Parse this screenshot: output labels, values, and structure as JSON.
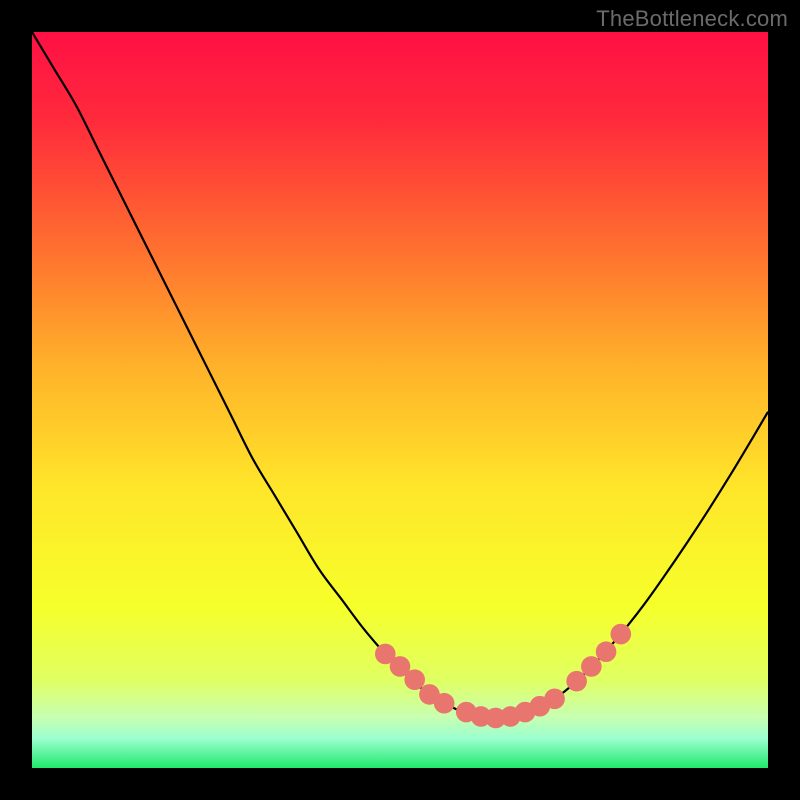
{
  "watermark": "TheBottleneck.com",
  "chart_data": {
    "type": "line",
    "title": "",
    "xlabel": "",
    "ylabel": "",
    "xlim": [
      0,
      100
    ],
    "ylim": [
      0,
      100
    ],
    "gradient_stops": [
      {
        "offset": 0,
        "color": "#ff1044"
      },
      {
        "offset": 12,
        "color": "#ff2a3c"
      },
      {
        "offset": 28,
        "color": "#ff6a30"
      },
      {
        "offset": 45,
        "color": "#ffb02a"
      },
      {
        "offset": 62,
        "color": "#ffe62a"
      },
      {
        "offset": 78,
        "color": "#f6ff2a"
      },
      {
        "offset": 88,
        "color": "#e0ff62"
      },
      {
        "offset": 93,
        "color": "#c8ffb0"
      },
      {
        "offset": 96,
        "color": "#9cffd0"
      },
      {
        "offset": 100,
        "color": "#20e86c"
      }
    ],
    "series": [
      {
        "name": "curve",
        "stroke": "#000000",
        "x": [
          0,
          3,
          6,
          9,
          12,
          15,
          18,
          21,
          24,
          27,
          30,
          33,
          36,
          39,
          42,
          45,
          48,
          51,
          54,
          57,
          59,
          61,
          63,
          65,
          68,
          71,
          74,
          77,
          80,
          83,
          86,
          89,
          92,
          95,
          98,
          100
        ],
        "y": [
          100,
          95,
          90,
          84,
          78,
          72,
          66,
          60,
          54,
          48,
          42,
          37,
          32,
          27,
          23,
          19,
          15.5,
          12.5,
          10,
          8.3,
          7.4,
          6.9,
          6.7,
          6.9,
          7.8,
          9.4,
          11.8,
          14.8,
          18.2,
          22.0,
          26.2,
          30.6,
          35.2,
          40.0,
          45.0,
          48.4
        ]
      }
    ],
    "markers": {
      "color": "#e8766f",
      "radius": 1.4,
      "points": [
        {
          "x": 48,
          "y": 15.5
        },
        {
          "x": 50,
          "y": 13.8
        },
        {
          "x": 52,
          "y": 12.0
        },
        {
          "x": 54,
          "y": 10.0
        },
        {
          "x": 56,
          "y": 8.8
        },
        {
          "x": 59,
          "y": 7.6
        },
        {
          "x": 61,
          "y": 7.0
        },
        {
          "x": 63,
          "y": 6.8
        },
        {
          "x": 65,
          "y": 7.0
        },
        {
          "x": 67,
          "y": 7.6
        },
        {
          "x": 69,
          "y": 8.4
        },
        {
          "x": 71,
          "y": 9.4
        },
        {
          "x": 74,
          "y": 11.8
        },
        {
          "x": 76,
          "y": 13.8
        },
        {
          "x": 78,
          "y": 15.8
        },
        {
          "x": 80,
          "y": 18.2
        }
      ]
    }
  }
}
